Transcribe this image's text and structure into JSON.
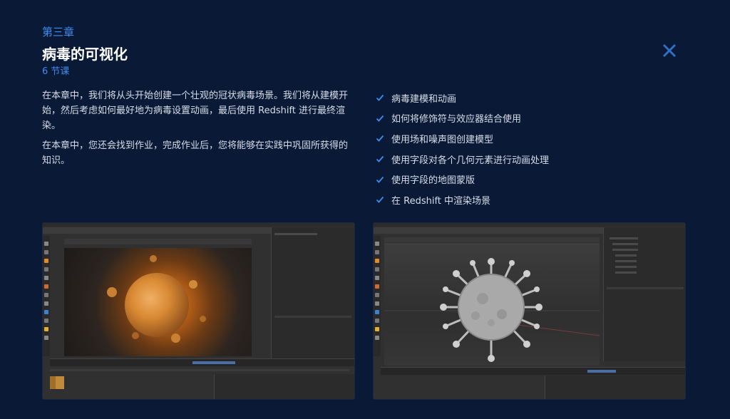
{
  "chapter": {
    "label": "第三章",
    "title": "病毒的可视化",
    "lessons": "6 节课"
  },
  "description": [
    "在本章中，我们将从头开始创建一个壮观的冠状病毒场景。我们将从建模开始，然后考虑如何最好地为病毒设置动画，最后使用 Redshift 进行最终渲染。",
    "在本章中，您还会找到作业，完成作业后，您将能够在实践中巩固所获得的知识。"
  ],
  "checklist": [
    "病毒建模和动画",
    "如何将修饰符与效应器结合使用",
    "使用场和噪声图创建模型",
    "使用字段对各个几何元素进行动画处理",
    "使用字段的地图蒙版",
    "在 Redshift 中渲染场景"
  ],
  "icons": {
    "close": "close-icon",
    "check": "check-icon"
  },
  "colors": {
    "background": "#0a1a36",
    "accent": "#3d8cf0",
    "check": "#3d8cf0"
  }
}
